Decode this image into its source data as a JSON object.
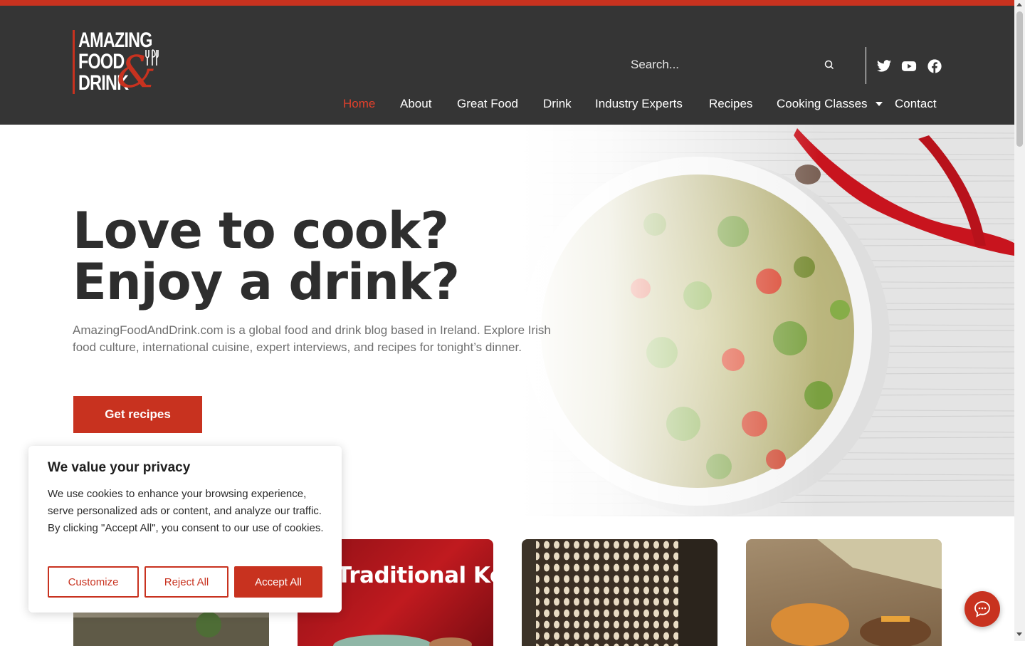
{
  "brand": {
    "logo_lines": [
      "AMAZING",
      "FOOD",
      "DRINK"
    ],
    "logo_amp": "&",
    "accent": "#c8321f",
    "header_bg": "#353535"
  },
  "search": {
    "placeholder": "Search...",
    "icon": "search-icon"
  },
  "social": [
    {
      "name": "twitter-icon"
    },
    {
      "name": "youtube-icon"
    },
    {
      "name": "facebook-icon"
    }
  ],
  "nav": {
    "items": [
      {
        "label": "Home",
        "active": true
      },
      {
        "label": "About"
      },
      {
        "label": "Great Food"
      },
      {
        "label": "Drink"
      },
      {
        "label": "Industry Experts"
      },
      {
        "label": "Recipes"
      },
      {
        "label": "Cooking Classes",
        "has_dropdown": true
      },
      {
        "label": "Contact"
      }
    ]
  },
  "hero": {
    "title_line1": "Love to cook?",
    "title_line2": "Enjoy a drink?",
    "lead": "AmazingFoodAndDrink.com is a global food and drink blog based in Ireland. Explore Irish food culture, international cuisine, expert interviews, and recipes for tonight’s dinner.",
    "cta": "Get recipes"
  },
  "cards": [
    {
      "title": ""
    },
    {
      "title": "Traditional Korean Tea"
    },
    {
      "title": ""
    },
    {
      "title": ""
    }
  ],
  "cookie": {
    "title": "We value your privacy",
    "text": "We use cookies to enhance your browsing experience, serve personalized ads or content, and analyze our traffic. By clicking \"Accept All\", you consent to our use of cookies.",
    "customize": "Customize",
    "reject": "Reject All",
    "accept": "Accept All"
  },
  "chat": {
    "icon": "chat-icon"
  }
}
